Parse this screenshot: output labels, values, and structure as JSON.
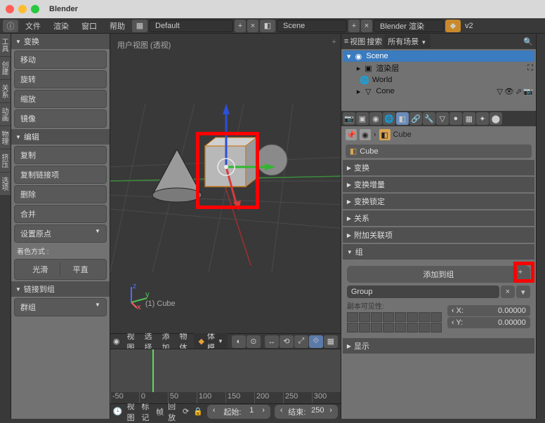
{
  "titlebar": {
    "title": "Blender"
  },
  "menubar": {
    "items": [
      "文件",
      "渲染",
      "窗口",
      "帮助"
    ],
    "layout": "Default",
    "scene": "Scene",
    "engine": "Blender 渲染",
    "version": "v2"
  },
  "left_tabs": [
    "工具",
    "创建",
    "关系",
    "动画",
    "物理",
    "挤压",
    "选项"
  ],
  "left_panel": {
    "transform": {
      "title": "变换",
      "buttons": [
        "移动",
        "旋转",
        "缩放",
        "镜像"
      ]
    },
    "edit": {
      "title": "编辑",
      "buttons": [
        "复制",
        "复制链接项",
        "删除",
        "合并",
        "设置原点"
      ]
    },
    "shade_label": "着色方式 :",
    "shade": [
      "光滑",
      "平直"
    ],
    "link": {
      "title": "链接到组",
      "group": "群组"
    }
  },
  "viewport": {
    "label": "用户视图 (透视)",
    "object": "(1) Cube",
    "header_items": [
      "视图",
      "选择",
      "添加",
      "物体"
    ],
    "mode": "物体模式"
  },
  "timeline": {
    "ticks": [
      "-50",
      "0",
      "50",
      "100",
      "150",
      "200",
      "250",
      "300"
    ],
    "header": [
      "视图",
      "标记",
      "帧",
      "回放"
    ],
    "start": {
      "label": "起始:",
      "value": "1"
    },
    "end": {
      "label": "结束:",
      "value": "250"
    }
  },
  "outliner": {
    "header": {
      "view": "视图",
      "search": "搜索",
      "filter": "所有场景"
    },
    "tree": [
      {
        "indent": 0,
        "exp": "▾",
        "icon": "scene",
        "label": "Scene",
        "sel": true
      },
      {
        "indent": 1,
        "exp": "▸",
        "icon": "layers",
        "label": "渲染层"
      },
      {
        "indent": 1,
        "exp": "",
        "icon": "world",
        "label": "World"
      },
      {
        "indent": 1,
        "exp": "▸",
        "icon": "mesh",
        "label": "Cone",
        "actions": true
      }
    ]
  },
  "props": {
    "breadcrumb": "Cube",
    "name_field": "Cube",
    "sections": [
      "变换",
      "变换增量",
      "变换锁定",
      "关系",
      "附加关联项"
    ],
    "group_title": "组",
    "add_to_group": "添加到组",
    "group_name": "Group",
    "dupli_label": "副本可见性:",
    "coords": [
      {
        "label": "X:",
        "value": "0.00000"
      },
      {
        "label": "Y:",
        "value": "0.00000"
      }
    ],
    "display": "显示"
  }
}
